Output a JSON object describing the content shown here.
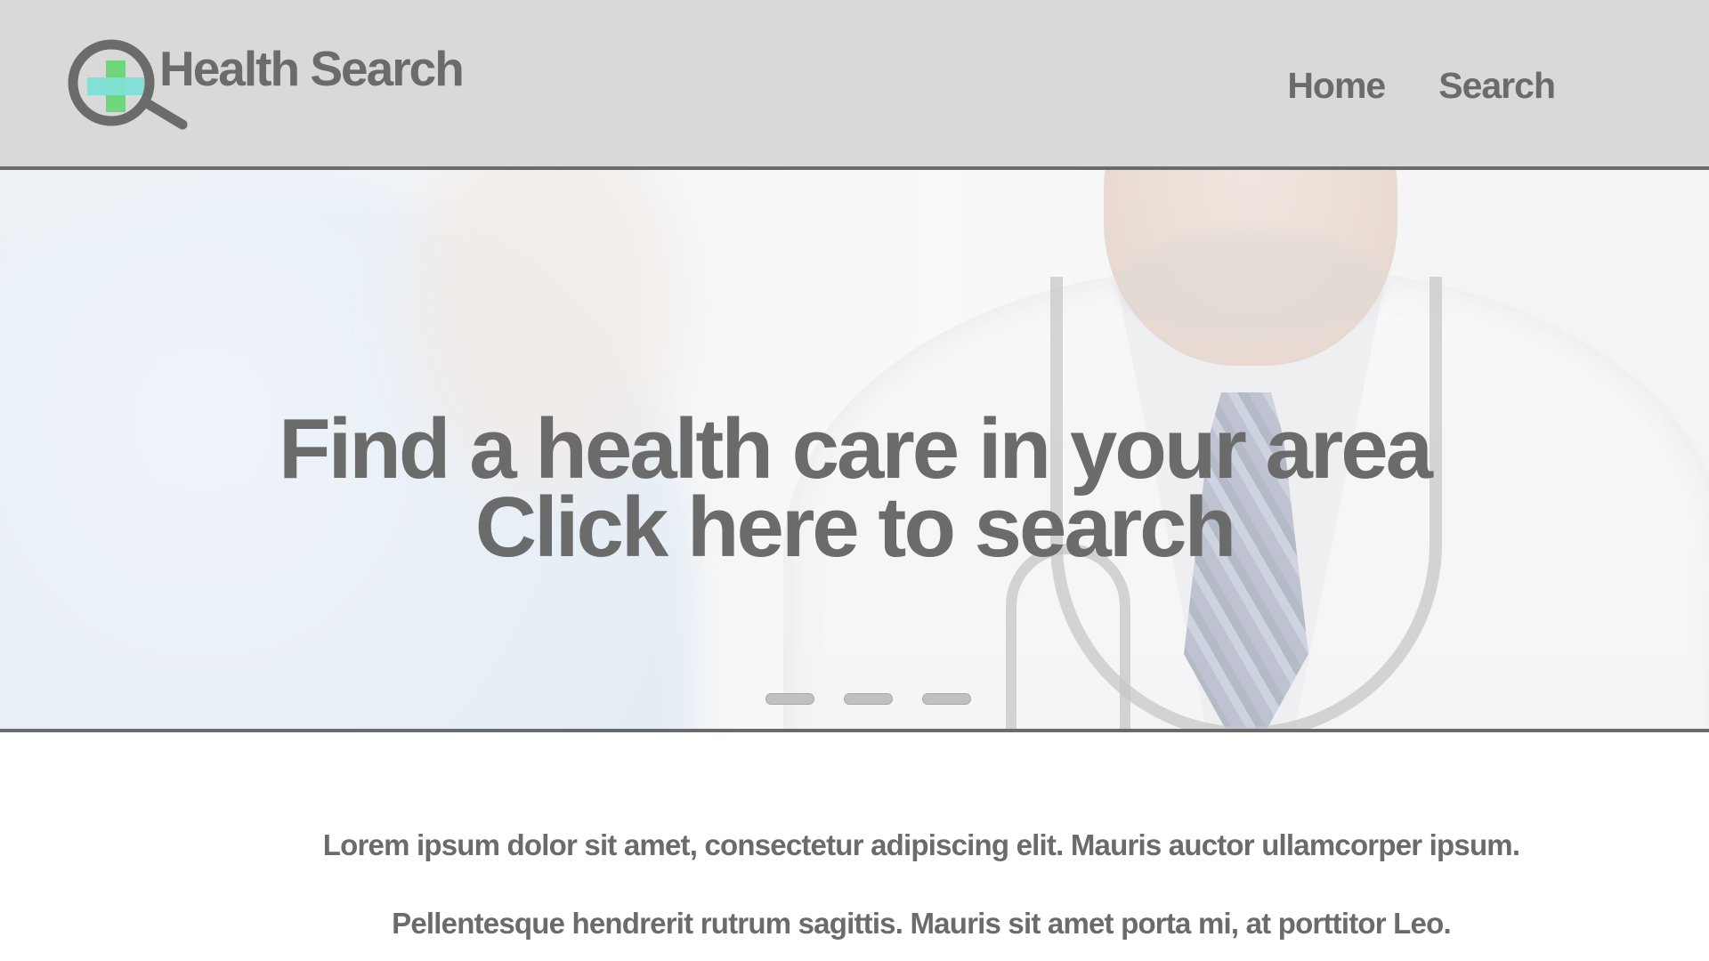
{
  "header": {
    "logo_text": "Health Search",
    "logo_icon": "magnifier-with-medical-cross-icon",
    "nav": [
      {
        "label": "Home"
      },
      {
        "label": "Search"
      }
    ]
  },
  "hero": {
    "title_line1": "Find a health care in your area",
    "title_line2": "Click here to search",
    "slides": 3,
    "background": "doctor-and-patient-photo"
  },
  "content": {
    "paragraph1": "Lorem ipsum dolor sit amet, consectetur adipiscing elit. Mauris auctor ullamcorper ipsum.",
    "paragraph2": "Pellentesque hendrerit rutrum sagittis. Mauris sit amet porta mi, at porttitor Leo."
  },
  "colors": {
    "header_bg": "#d9d9d9",
    "text": "#6b6b6b",
    "cross_green": "#6fd67c",
    "cross_teal": "#7de0d6",
    "divider": "#6b6b6b"
  }
}
